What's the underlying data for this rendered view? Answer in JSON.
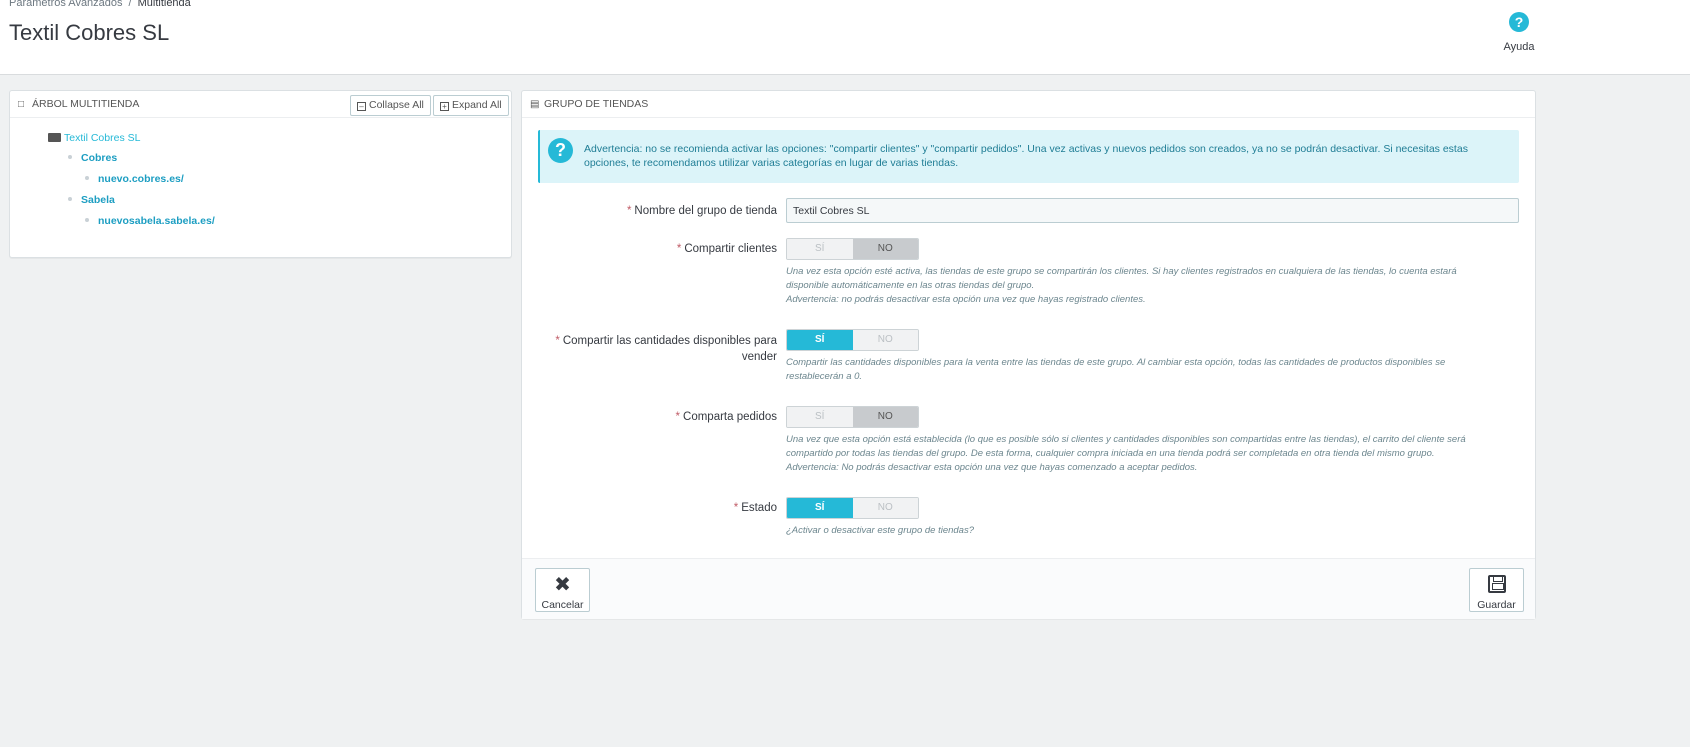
{
  "breadcrumb": {
    "parent": "Parámetros Avanzados",
    "separator": "/",
    "current": "Multitienda"
  },
  "page_title": "Textil Cobres SL",
  "help": {
    "icon": "help-circle-icon",
    "label": "Ayuda"
  },
  "tree_panel": {
    "heading": "ÁRBOL MULTITIENDA",
    "collapse_label": "Collapse All",
    "expand_label": "Expand All",
    "root": "Textil Cobres SL",
    "groups": [
      {
        "name": "Cobres",
        "shops": [
          "nuevo.cobres.es/"
        ]
      },
      {
        "name": "Sabela",
        "shops": [
          "nuevosabela.sabela.es/"
        ]
      }
    ]
  },
  "group_panel": {
    "heading": "GRUPO DE TIENDAS",
    "alert": "Advertencia: no se recomienda activar las opciones: \"compartir clientes\" y \"compartir pedidos\". Una vez activas y nuevos pedidos son creados, ya no se podrán desactivar. Si necesitas estas opciones, te recomendamos utilizar varias categorías en lugar de varias tiendas.",
    "name_field": {
      "label": "Nombre del grupo de tienda",
      "value": "Textil Cobres SL"
    },
    "share_customers": {
      "label": "Compartir clientes",
      "yes": "SÍ",
      "no": "NO",
      "selected": "NO",
      "help": "Una vez esta opción esté activa, las tiendas de este grupo se compartirán los clientes. Si hay clientes registrados en cualquiera de las tiendas, lo cuenta estará disponible automáticamente en las otras tiendas del grupo.",
      "help2": "Advertencia: no podrás desactivar esta opción una vez que hayas registrado clientes."
    },
    "share_stock": {
      "label": "Compartir las cantidades disponibles para vender",
      "yes": "SÍ",
      "no": "NO",
      "selected": "SÍ",
      "help": "Compartir las cantidades disponibles para la venta entre las tiendas de este grupo. Al cambiar esta opción, todas las cantidades de productos disponibles se restablecerán a 0."
    },
    "share_orders": {
      "label": "Comparta pedidos",
      "yes": "SÍ",
      "no": "NO",
      "selected": "NO",
      "help": "Una vez que esta opción está establecida (lo que es posible sólo si clientes y cantidades disponibles son compartidas entre las tiendas), el carrito del cliente será compartido por todas las tiendas del grupo. De esta forma, cualquier compra iniciada en una tienda podrá ser completada en otra tienda del mismo grupo.",
      "help2": "Advertencia: No podrás desactivar esta opción una vez que hayas comenzado a aceptar pedidos."
    },
    "status": {
      "label": "Estado",
      "yes": "SÍ",
      "no": "NO",
      "selected": "SÍ",
      "help": "¿Activar o desactivar este grupo de tiendas?"
    },
    "cancel_label": "Cancelar",
    "save_label": "Guardar"
  },
  "colors": {
    "accent": "#25b9d7",
    "required": "#c05c67",
    "alert_bg": "#dcf4f9"
  }
}
